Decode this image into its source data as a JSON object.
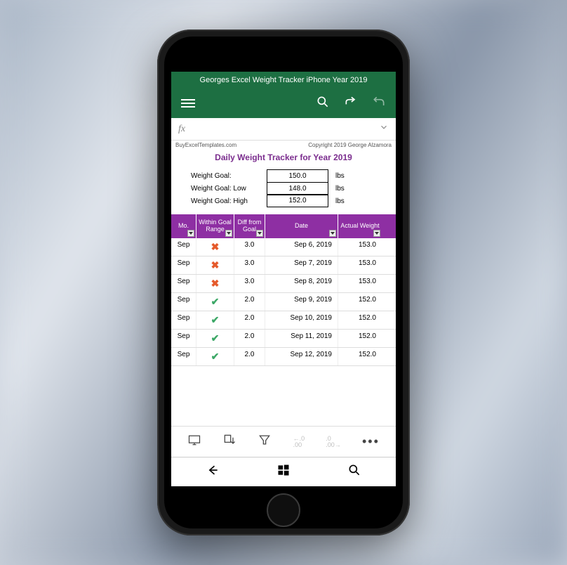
{
  "header": {
    "title": "Georges Excel Weight Tracker iPhone Year 2019"
  },
  "meta": {
    "site": "BuyExcelTemplates.com",
    "copyright": "Copyright 2019  George Alzamora"
  },
  "page_title": "Daily Weight Tracker for Year 2019",
  "goals": [
    {
      "label": "Weight Goal:",
      "value": "150.0",
      "unit": "lbs"
    },
    {
      "label": "Weight Goal: Low",
      "value": "148.0",
      "unit": "lbs"
    },
    {
      "label": "Weight Goal: High",
      "value": "152.0",
      "unit": "lbs"
    }
  ],
  "table": {
    "headers": {
      "mo": "Mo.",
      "within": "Within Goal Range",
      "diff": "Diff from Goal",
      "date": "Date",
      "actual": "Actual Weight"
    },
    "rows": [
      {
        "mo": "Sep",
        "inRange": false,
        "diff": "3.0",
        "date": "Sep 6, 2019",
        "weight": "153.0"
      },
      {
        "mo": "Sep",
        "inRange": false,
        "diff": "3.0",
        "date": "Sep 7, 2019",
        "weight": "153.0"
      },
      {
        "mo": "Sep",
        "inRange": false,
        "diff": "3.0",
        "date": "Sep 8, 2019",
        "weight": "153.0"
      },
      {
        "mo": "Sep",
        "inRange": true,
        "diff": "2.0",
        "date": "Sep 9, 2019",
        "weight": "152.0"
      },
      {
        "mo": "Sep",
        "inRange": true,
        "diff": "2.0",
        "date": "Sep 10, 2019",
        "weight": "152.0"
      },
      {
        "mo": "Sep",
        "inRange": true,
        "diff": "2.0",
        "date": "Sep 11, 2019",
        "weight": "152.0"
      },
      {
        "mo": "Sep",
        "inRange": true,
        "diff": "2.0",
        "date": "Sep 12, 2019",
        "weight": "152.0"
      }
    ]
  },
  "icons": {
    "decimal_inc": "←.0 .00",
    "decimal_dec": ".0 .00→"
  }
}
